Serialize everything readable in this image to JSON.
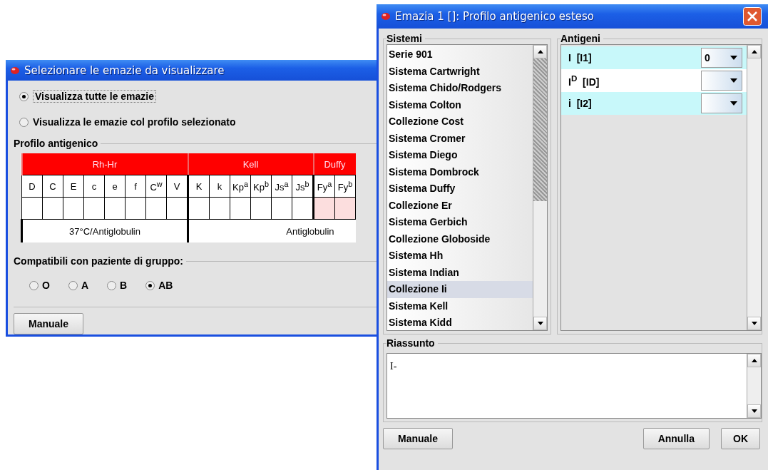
{
  "select_window": {
    "title": "Selezionare le emazie da visualizzare",
    "view_options": [
      {
        "label": "Visualizza tutte le emazie",
        "selected": true
      },
      {
        "label": "Visualizza le emazie col profilo selezionato",
        "selected": false
      }
    ],
    "profile": {
      "legend": "Profilo antigenico",
      "groups": [
        {
          "name": "Rh-Hr",
          "shaded": false,
          "antigens": [
            "D",
            "C",
            "E",
            "c",
            "e",
            "f",
            "C$^{w}$",
            "V"
          ]
        },
        {
          "name": "Kell",
          "shaded": false,
          "antigens": [
            "K",
            "k",
            "Kp$^{a}$",
            "Kp$^{b}$",
            "Js$^{a}$",
            "Js$^{b}$"
          ]
        },
        {
          "name": "Duffy",
          "shaded": true,
          "antigens": [
            "Fy$^{a}$",
            "Fy$^{b}$"
          ]
        }
      ],
      "methods": [
        {
          "label": "37°C/Antiglobulin"
        },
        {
          "label": "Antiglobulin"
        }
      ]
    },
    "compat": {
      "legend": "Compatibili con paziente di gruppo:",
      "groups": [
        {
          "label": "O",
          "selected": false
        },
        {
          "label": "A",
          "selected": false
        },
        {
          "label": "B",
          "selected": false
        },
        {
          "label": "AB",
          "selected": true
        }
      ]
    },
    "buttons": [
      "Manuale"
    ]
  },
  "profile_window": {
    "title": "Emazia 1 []: Profilo antigenico esteso",
    "systems": {
      "legend": "Sistemi",
      "items": [
        {
          "label": "Serie 901",
          "selected": false
        },
        {
          "label": "Sistema Cartwright",
          "selected": false
        },
        {
          "label": "Sistema Chido/Rodgers",
          "selected": false
        },
        {
          "label": "Sistema Colton",
          "selected": false
        },
        {
          "label": "Collezione Cost",
          "selected": false
        },
        {
          "label": "Sistema Cromer",
          "selected": false
        },
        {
          "label": "Sistema Diego",
          "selected": false
        },
        {
          "label": "Sistema Dombrock",
          "selected": false
        },
        {
          "label": "Sistema Duffy",
          "selected": false
        },
        {
          "label": "Collezione Er",
          "selected": false
        },
        {
          "label": "Sistema Gerbich",
          "selected": false
        },
        {
          "label": "Collezione Globoside",
          "selected": false
        },
        {
          "label": "Sistema Hh",
          "selected": false
        },
        {
          "label": "Sistema Indian",
          "selected": false
        },
        {
          "label": "Collezione Ii",
          "selected": true
        },
        {
          "label": "Sistema Kell",
          "selected": false
        },
        {
          "label": "Sistema Kidd",
          "selected": false
        }
      ]
    },
    "antigens": {
      "legend": "Antigeni",
      "rows": [
        {
          "label": "I  [I1]",
          "value": "0"
        },
        {
          "label": "I$^{D}$  [ID]"
        },
        {
          "label": "i  [I2]"
        }
      ]
    },
    "summary": {
      "legend": "Riassunto",
      "value": "I-"
    },
    "buttons_left": [
      "Manuale"
    ],
    "buttons_right": [
      "Annulla",
      "OK"
    ]
  }
}
